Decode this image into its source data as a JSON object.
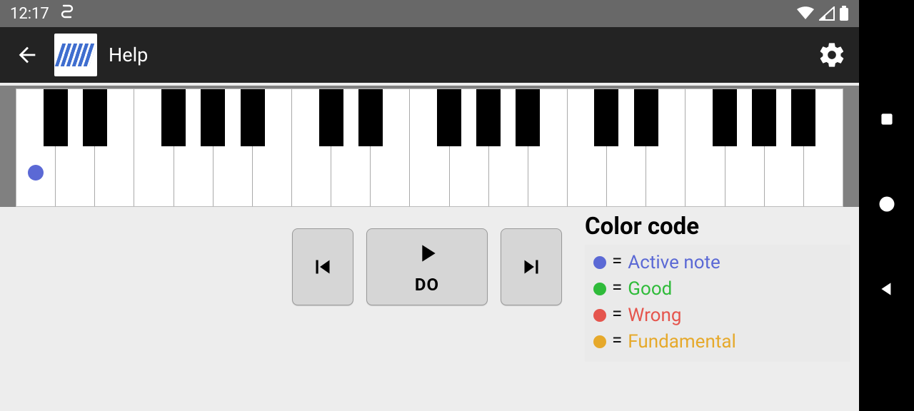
{
  "status": {
    "time": "12:17"
  },
  "appbar": {
    "title": "Help"
  },
  "piano": {
    "white_key_count": 21,
    "active_key_index": 0,
    "black_key_pattern": [
      0,
      1,
      3,
      4,
      5
    ]
  },
  "controls": {
    "current_note": "DO"
  },
  "legend": {
    "title": "Color code",
    "items": [
      {
        "color": "#5b69d5",
        "label": "Active note",
        "label_color": "#5b69d5"
      },
      {
        "color": "#2fbb3a",
        "label": "Good",
        "label_color": "#2fbb3a"
      },
      {
        "color": "#e5554d",
        "label": "Wrong",
        "label_color": "#e5554d"
      },
      {
        "color": "#e6a92b",
        "label": "Fundamental",
        "label_color": "#e6a92b"
      }
    ]
  },
  "colors": {
    "active_dot": "#5b69d5"
  }
}
